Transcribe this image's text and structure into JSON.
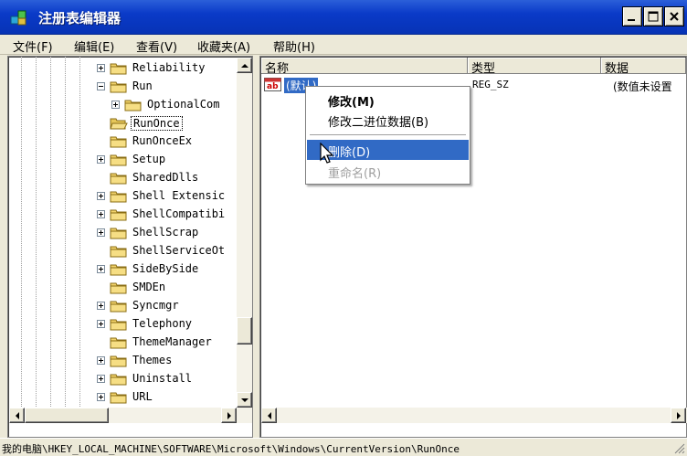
{
  "window": {
    "title": "注册表编辑器",
    "colors": {
      "title_bar": "#0a3ac8",
      "selection": "#316ac5",
      "face": "#ece9d8"
    }
  },
  "menu": [
    "文件(F)",
    "编辑(E)",
    "查看(V)",
    "收藏夹(A)",
    "帮助(H)"
  ],
  "tree": {
    "items": [
      {
        "label": "Reliability",
        "expander": "plus",
        "level": 0
      },
      {
        "label": "Run",
        "expander": "minus",
        "level": 0
      },
      {
        "label": "OptionalCom",
        "expander": "plus",
        "level": 1
      },
      {
        "label": "RunOnce",
        "expander": "none",
        "level": 0,
        "selected": true,
        "icon": "open-folder"
      },
      {
        "label": "RunOnceEx",
        "expander": "none",
        "level": 0
      },
      {
        "label": "Setup",
        "expander": "plus",
        "level": 0
      },
      {
        "label": "SharedDlls",
        "expander": "none",
        "level": 0
      },
      {
        "label": "Shell Extensic",
        "expander": "plus",
        "level": 0
      },
      {
        "label": "ShellCompatibi",
        "expander": "plus",
        "level": 0
      },
      {
        "label": "ShellScrap",
        "expander": "plus",
        "level": 0
      },
      {
        "label": "ShellServiceOt",
        "expander": "none",
        "level": 0
      },
      {
        "label": "SideBySide",
        "expander": "plus",
        "level": 0
      },
      {
        "label": "SMDEn",
        "expander": "none",
        "level": 0
      },
      {
        "label": "Syncmgr",
        "expander": "plus",
        "level": 0
      },
      {
        "label": "Telephony",
        "expander": "plus",
        "level": 0
      },
      {
        "label": "ThemeManager",
        "expander": "none",
        "level": 0
      },
      {
        "label": "Themes",
        "expander": "plus",
        "level": 0
      },
      {
        "label": "Uninstall",
        "expander": "plus",
        "level": 0
      },
      {
        "label": "URL",
        "expander": "plus",
        "level": 0
      }
    ]
  },
  "list": {
    "columns": [
      "名称",
      "类型",
      "数据"
    ],
    "rows": [
      {
        "name": "(默认)",
        "type": "REG_SZ",
        "data": "(数值未设置"
      }
    ]
  },
  "context_menu": {
    "items": [
      {
        "label": "修改(M)",
        "bold": true,
        "state": "normal"
      },
      {
        "label": "修改二进位数据(B)",
        "state": "normal"
      },
      {
        "label": "删除(D)",
        "state": "highlighted"
      },
      {
        "label": "重命名(R)",
        "state": "disabled"
      }
    ]
  },
  "status": {
    "path": "我的电脑\\HKEY_LOCAL_MACHINE\\SOFTWARE\\Microsoft\\Windows\\CurrentVersion\\RunOnce"
  },
  "icons": [
    "registry-editor-icon",
    "folder-icon",
    "open-folder-icon",
    "string-value-icon",
    "cursor-icon"
  ]
}
